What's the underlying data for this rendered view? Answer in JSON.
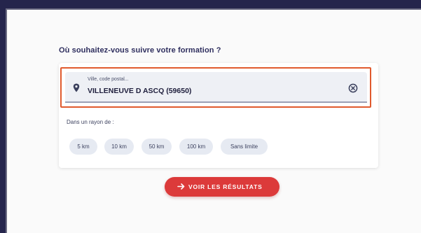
{
  "form": {
    "question": "Où souhaitez-vous suivre votre formation ?",
    "location": {
      "label": "Ville, code postal...",
      "value": "VILLENEUVE D ASCQ (59650)",
      "icon": "map-pin-icon",
      "clear_icon": "clear-circle-icon"
    },
    "radius": {
      "label": "Dans un rayon de :",
      "options": [
        "5 km",
        "10 km",
        "50 km",
        "100 km",
        "Sans limite"
      ]
    },
    "submit_label": "VOIR LES RÉSULTATS",
    "submit_icon": "arrow-right-icon"
  },
  "colors": {
    "background_frame": "#25254c",
    "highlight": "#e05a2e",
    "cta": "#dc3a3a",
    "heading": "#2e2e5e"
  }
}
